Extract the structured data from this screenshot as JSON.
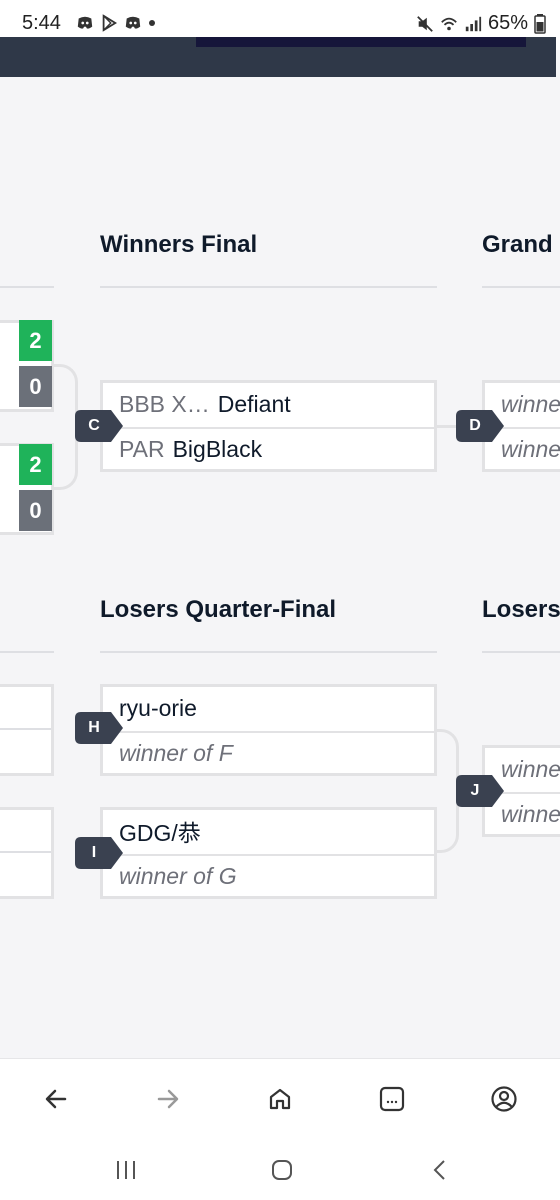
{
  "status_bar": {
    "time": "5:44",
    "battery": "65%",
    "left_icons": [
      "discord-icon",
      "play-store-icon",
      "discord-icon",
      "dot-icon"
    ],
    "right_icons": [
      "mute-icon",
      "wifi-icon",
      "signal-icon",
      "battery-icon"
    ]
  },
  "sections": {
    "winners_final": "Winners Final",
    "grand": "Grand",
    "losers_qf": "Losers Quarter-Final",
    "losers": "Losers"
  },
  "left_column": {
    "scores": [
      "2",
      "0",
      "2",
      "0"
    ]
  },
  "matches": {
    "c": {
      "badge": "C",
      "p1_tag": "BBB X…",
      "p1_name": "Defiant",
      "p2_tag": "PAR",
      "p2_name": "BigBlack"
    },
    "d": {
      "badge": "D",
      "p1": "winne",
      "p2": "winne"
    },
    "h": {
      "badge": "H",
      "p1": "ryu-orie",
      "p2": "winner of F"
    },
    "i": {
      "badge": "I",
      "p1": "GDG/恭",
      "p2": "winner of G"
    },
    "j": {
      "badge": "J",
      "p1": "winne",
      "p2": "winne"
    }
  },
  "colors": {
    "win": "#1fb35a",
    "loss": "#6b7079",
    "badge": "#3a4150",
    "banner": "#2f3848"
  },
  "nav": [
    "back-icon",
    "forward-icon",
    "home-icon",
    "tabs-icon",
    "account-icon"
  ],
  "system_nav": [
    "recents-icon",
    "home-circle-icon",
    "back-chevron-icon"
  ]
}
